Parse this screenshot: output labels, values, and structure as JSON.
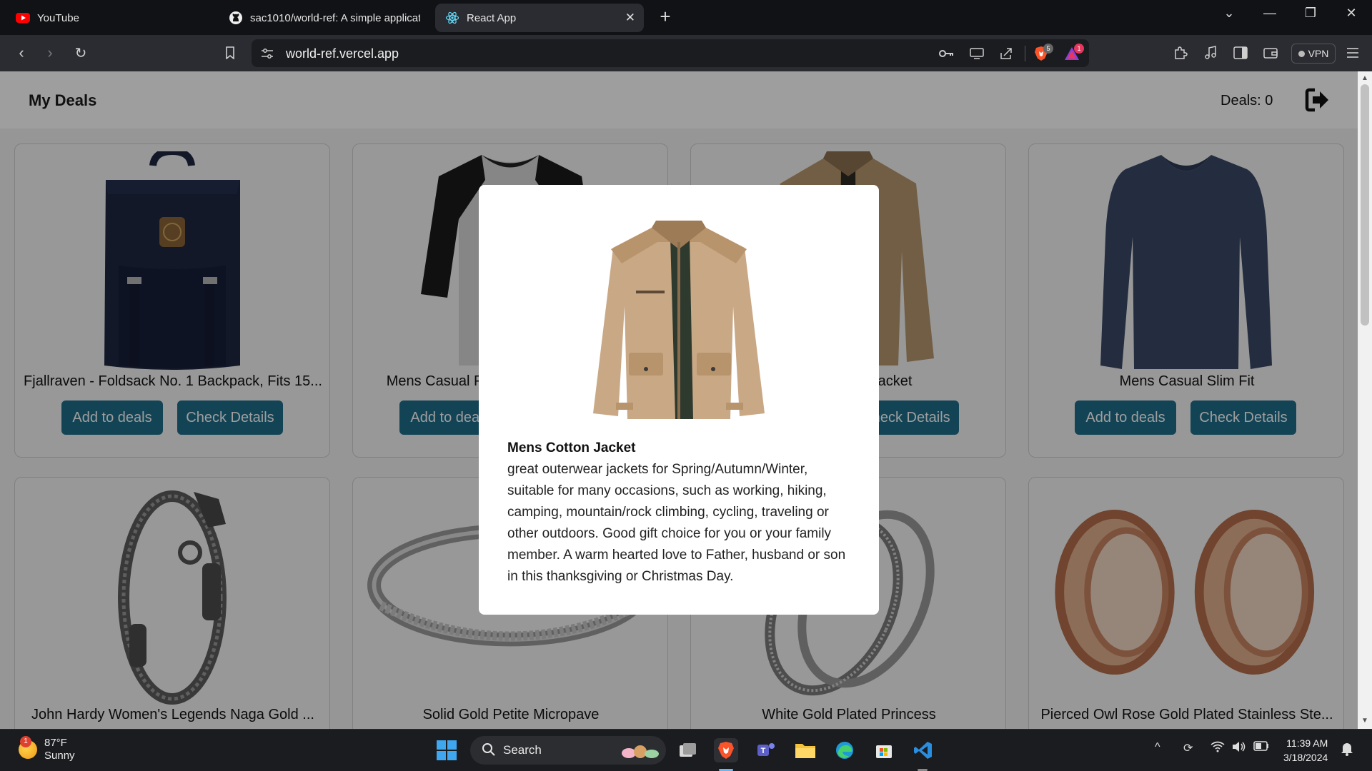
{
  "browser": {
    "tabs": [
      {
        "title": "YouTube",
        "icon": "youtube-icon"
      },
      {
        "title": "sac1010/world-ref: A simple applicat",
        "icon": "github-icon"
      },
      {
        "title": "React App",
        "icon": "react-icon",
        "active": true
      }
    ],
    "url": "world-ref.vercel.app",
    "vpn_label": "VPN",
    "brave_badge": "5",
    "rewards_badge": "1"
  },
  "app": {
    "title": "My Deals",
    "deals_label": "Deals: 0",
    "add_label": "Add to deals",
    "details_label": "Check Details",
    "products": [
      {
        "title": "Fjallraven - Foldsack No. 1 Backpack, Fits 15...",
        "image": "backpack"
      },
      {
        "title": "Mens Casual Premium Slim Fit T-Shirts",
        "image": "tshirt"
      },
      {
        "title": "Mens Cotton Jacket",
        "image": "jacket"
      },
      {
        "title": "Mens Casual Slim Fit",
        "image": "longsleeve"
      },
      {
        "title": "John Hardy Women's Legends Naga Gold ...",
        "image": "bracelet"
      },
      {
        "title": "Solid Gold Petite Micropave",
        "image": "ring"
      },
      {
        "title": "White Gold Plated Princess",
        "image": "rings"
      },
      {
        "title": "Pierced Owl Rose Gold Plated Stainless Ste...",
        "image": "plugs"
      }
    ],
    "modal": {
      "title": "Mens Cotton Jacket",
      "description": "great outerwear jackets for Spring/Autumn/Winter, suitable for many occasions, such as working, hiking, camping, mountain/rock climbing, cycling, traveling or other outdoors. Good gift choice for you or your family member. A warm hearted love to Father, husband or son in this thanksgiving or Christmas Day."
    }
  },
  "taskbar": {
    "weather_temp": "87°F",
    "weather_cond": "Sunny",
    "weather_badge": "1",
    "search_label": "Search",
    "time": "11:39 AM",
    "date": "3/18/2024"
  },
  "colors": {
    "accent": "#1f6f8b",
    "tab_bg": "#111215",
    "toolbar_bg": "#2b2c31"
  }
}
